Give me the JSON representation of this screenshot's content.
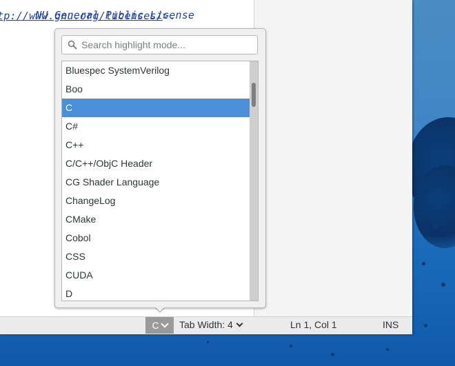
{
  "editor": {
    "line1": "NU General Public License",
    "line2_link": "tp://www.gnu.org/licenses/",
    "line2_tail": ">."
  },
  "highlight_popover": {
    "search_placeholder": "Search highlight mode...",
    "search_value": "",
    "items": [
      {
        "label": "Bluespec SystemVerilog",
        "selected": false
      },
      {
        "label": "Boo",
        "selected": false
      },
      {
        "label": "C",
        "selected": true
      },
      {
        "label": "C#",
        "selected": false
      },
      {
        "label": "C++",
        "selected": false
      },
      {
        "label": "C/C++/ObjC Header",
        "selected": false
      },
      {
        "label": "CG Shader Language",
        "selected": false
      },
      {
        "label": "ChangeLog",
        "selected": false
      },
      {
        "label": "CMake",
        "selected": false
      },
      {
        "label": "Cobol",
        "selected": false
      },
      {
        "label": "CSS",
        "selected": false
      },
      {
        "label": "CUDA",
        "selected": false
      },
      {
        "label": "D",
        "selected": false
      }
    ],
    "scroll": {
      "thumb_start": 0.09,
      "thumb_length": 0.1
    }
  },
  "statusbar": {
    "language_label": "C",
    "tab_width_label": "Tab Width: 4",
    "cursor_position": "Ln 1, Col 1",
    "insert_mode": "INS"
  },
  "colors": {
    "selection": "#4a90d9",
    "code_text": "#1f3fb0",
    "desktop_blue": "#1e6fbf"
  },
  "icons": {
    "search": "search-icon",
    "language_dropdown": "chevron-down-icon",
    "tab_width_dropdown": "chevron-down-icon"
  }
}
